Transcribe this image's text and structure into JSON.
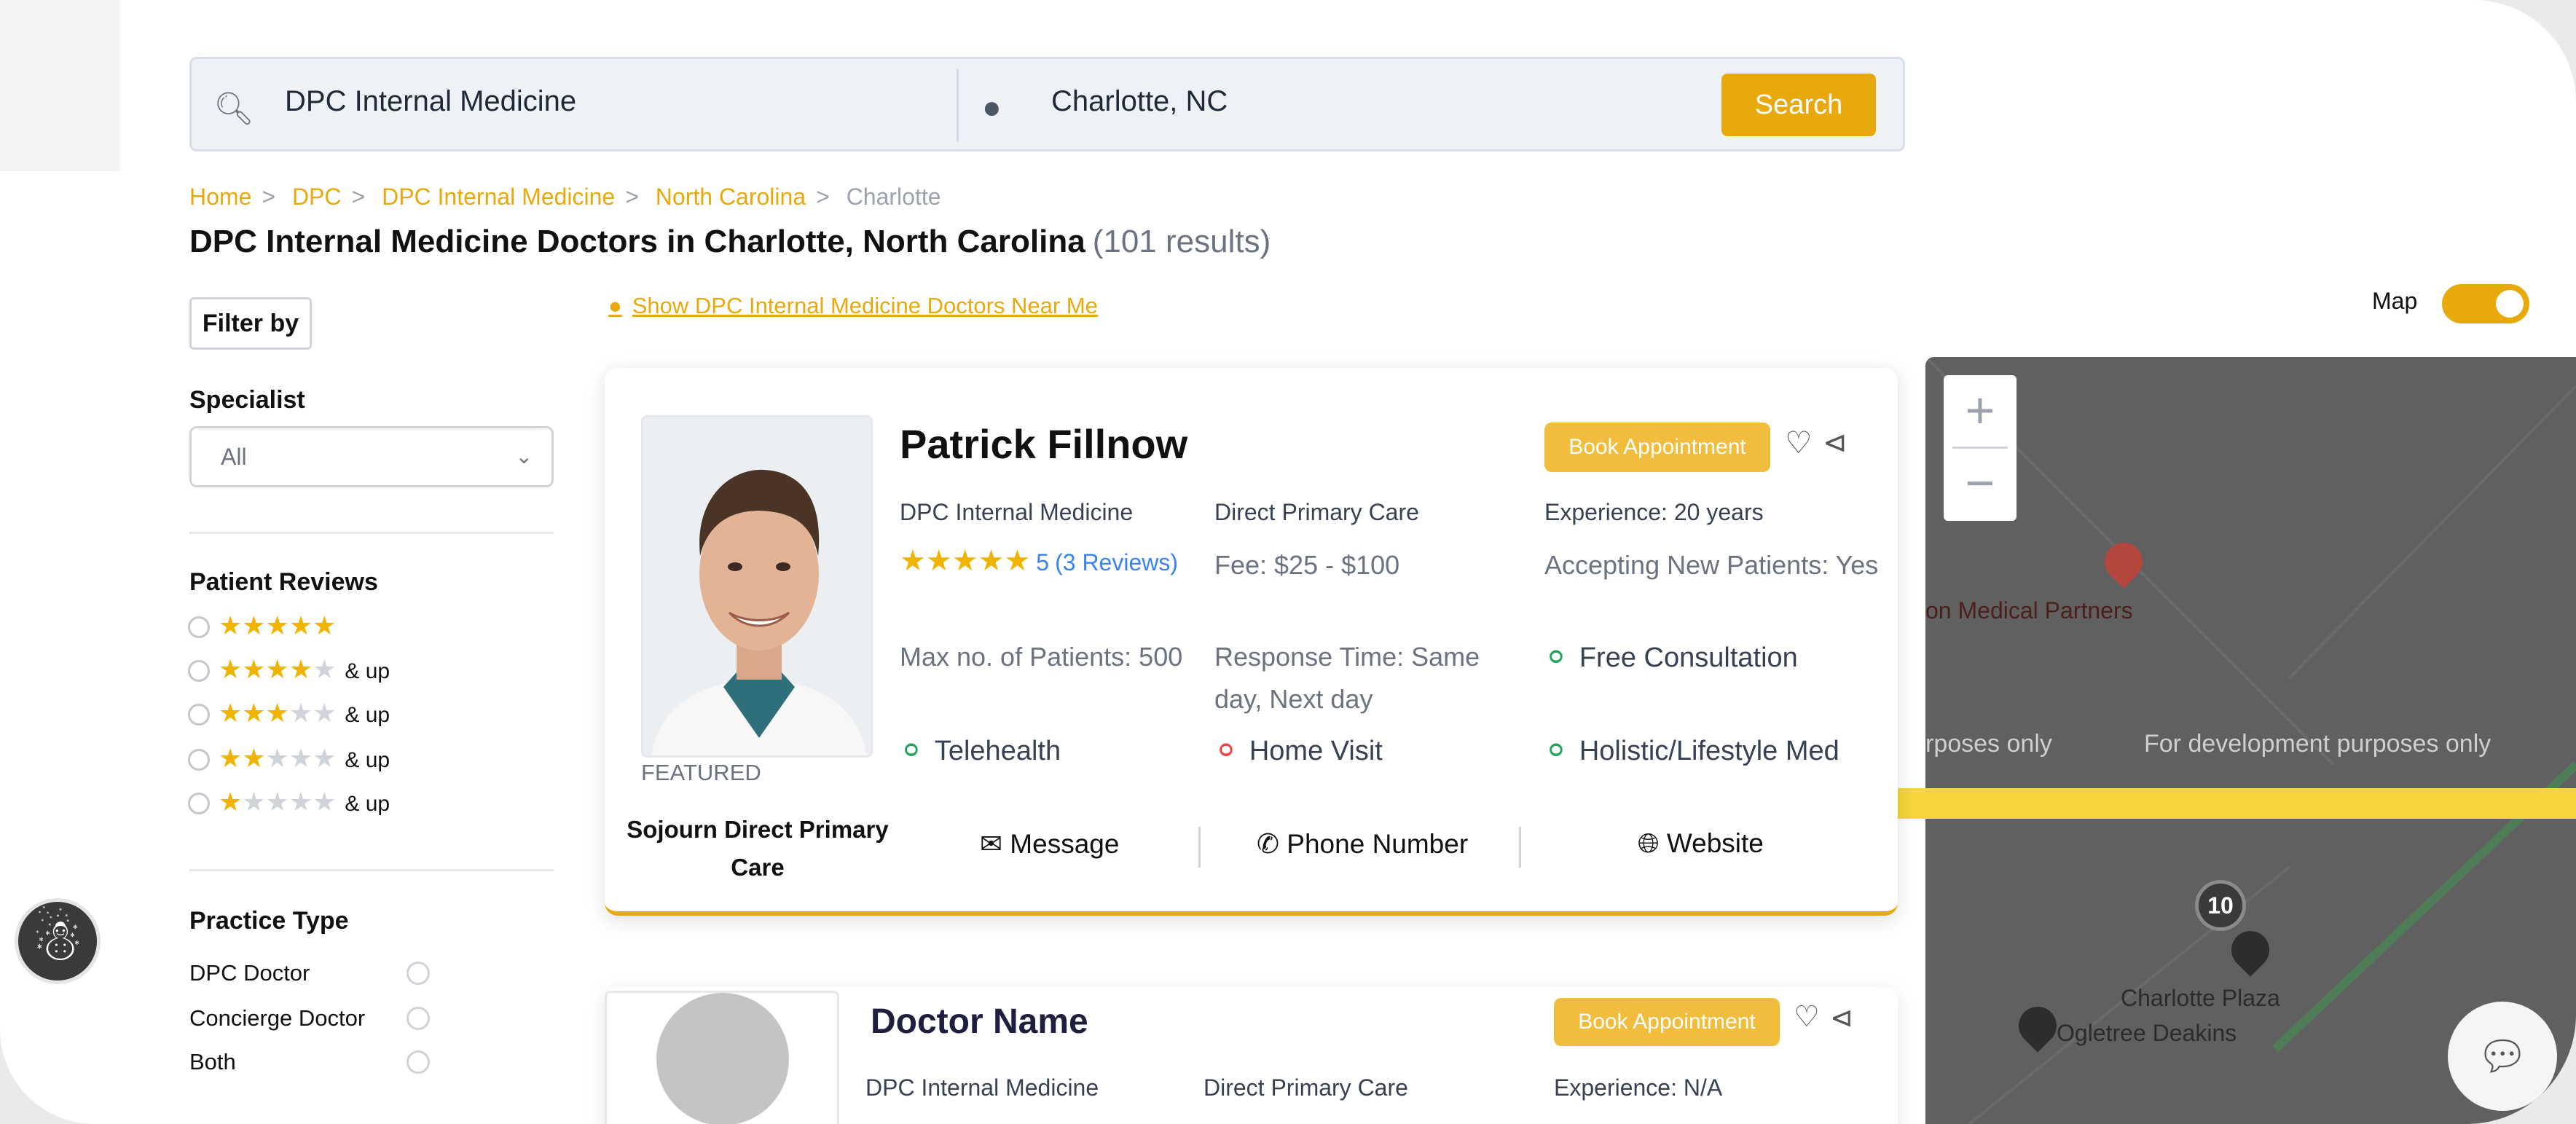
{
  "search": {
    "query": "DPC Internal Medicine",
    "location": "Charlotte, NC",
    "button": "Search"
  },
  "breadcrumb": [
    "Home",
    "DPC",
    "DPC Internal Medicine",
    "North Carolina",
    "Charlotte"
  ],
  "page": {
    "title": "DPC Internal Medicine Doctors in Charlotte, North Carolina",
    "result_count": "(101 results)",
    "near_me": "Show DPC Internal Medicine Doctors Near Me",
    "map_label": "Map",
    "map_toggle_on": true
  },
  "filters": {
    "filter_by": "Filter by",
    "specialist_label": "Specialist",
    "specialist_value": "All",
    "reviews_label": "Patient Reviews",
    "review_options": [
      {
        "stars": 5,
        "suffix": ""
      },
      {
        "stars": 4,
        "suffix": "& up"
      },
      {
        "stars": 3,
        "suffix": "& up"
      },
      {
        "stars": 2,
        "suffix": "& up"
      },
      {
        "stars": 1,
        "suffix": "& up"
      }
    ],
    "practice_type_label": "Practice Type",
    "practice_types": [
      "DPC Doctor",
      "Concierge Doctor",
      "Both"
    ]
  },
  "doctor": {
    "name": "Patrick Fillnow",
    "featured": "FEATURED",
    "practice": "Sojourn Direct Primary Care",
    "book": "Book Appointment",
    "specialty": "DPC Internal Medicine",
    "care_type": "Direct Primary Care",
    "experience": "Experience: 20 years",
    "rating": "5",
    "reviews": "(3 Reviews)",
    "fee": "Fee: $25 - $100",
    "accepting": "Accepting New Patients: Yes",
    "max_patients": "Max no. of Patients: 500",
    "response": "Response Time: Same day, Next day",
    "free_consult": "Free Consultation",
    "telehealth": "Telehealth",
    "home_visit": "Home Visit",
    "holistic": "Holistic/Lifestyle Med",
    "actions": {
      "message": "Message",
      "phone": "Phone Number",
      "website": "Website"
    }
  },
  "doctor2": {
    "name": "Doctor Name",
    "book": "Book Appointment",
    "specialty": "DPC Internal Medicine",
    "care_type": "Direct Primary Care",
    "experience": "Experience: N/A"
  },
  "map": {
    "zoom_in": "+",
    "zoom_out": "−",
    "label_partner": "on Medical Partners",
    "dev1": "rposes only",
    "dev2": "For development purposes only",
    "cluster": "10",
    "plaza": "Charlotte Plaza",
    "ogletree": "Ogletree Deakins"
  },
  "colors": {
    "accent": "#e8a90c",
    "star": "#f0b400",
    "map_bg": "#606060"
  }
}
